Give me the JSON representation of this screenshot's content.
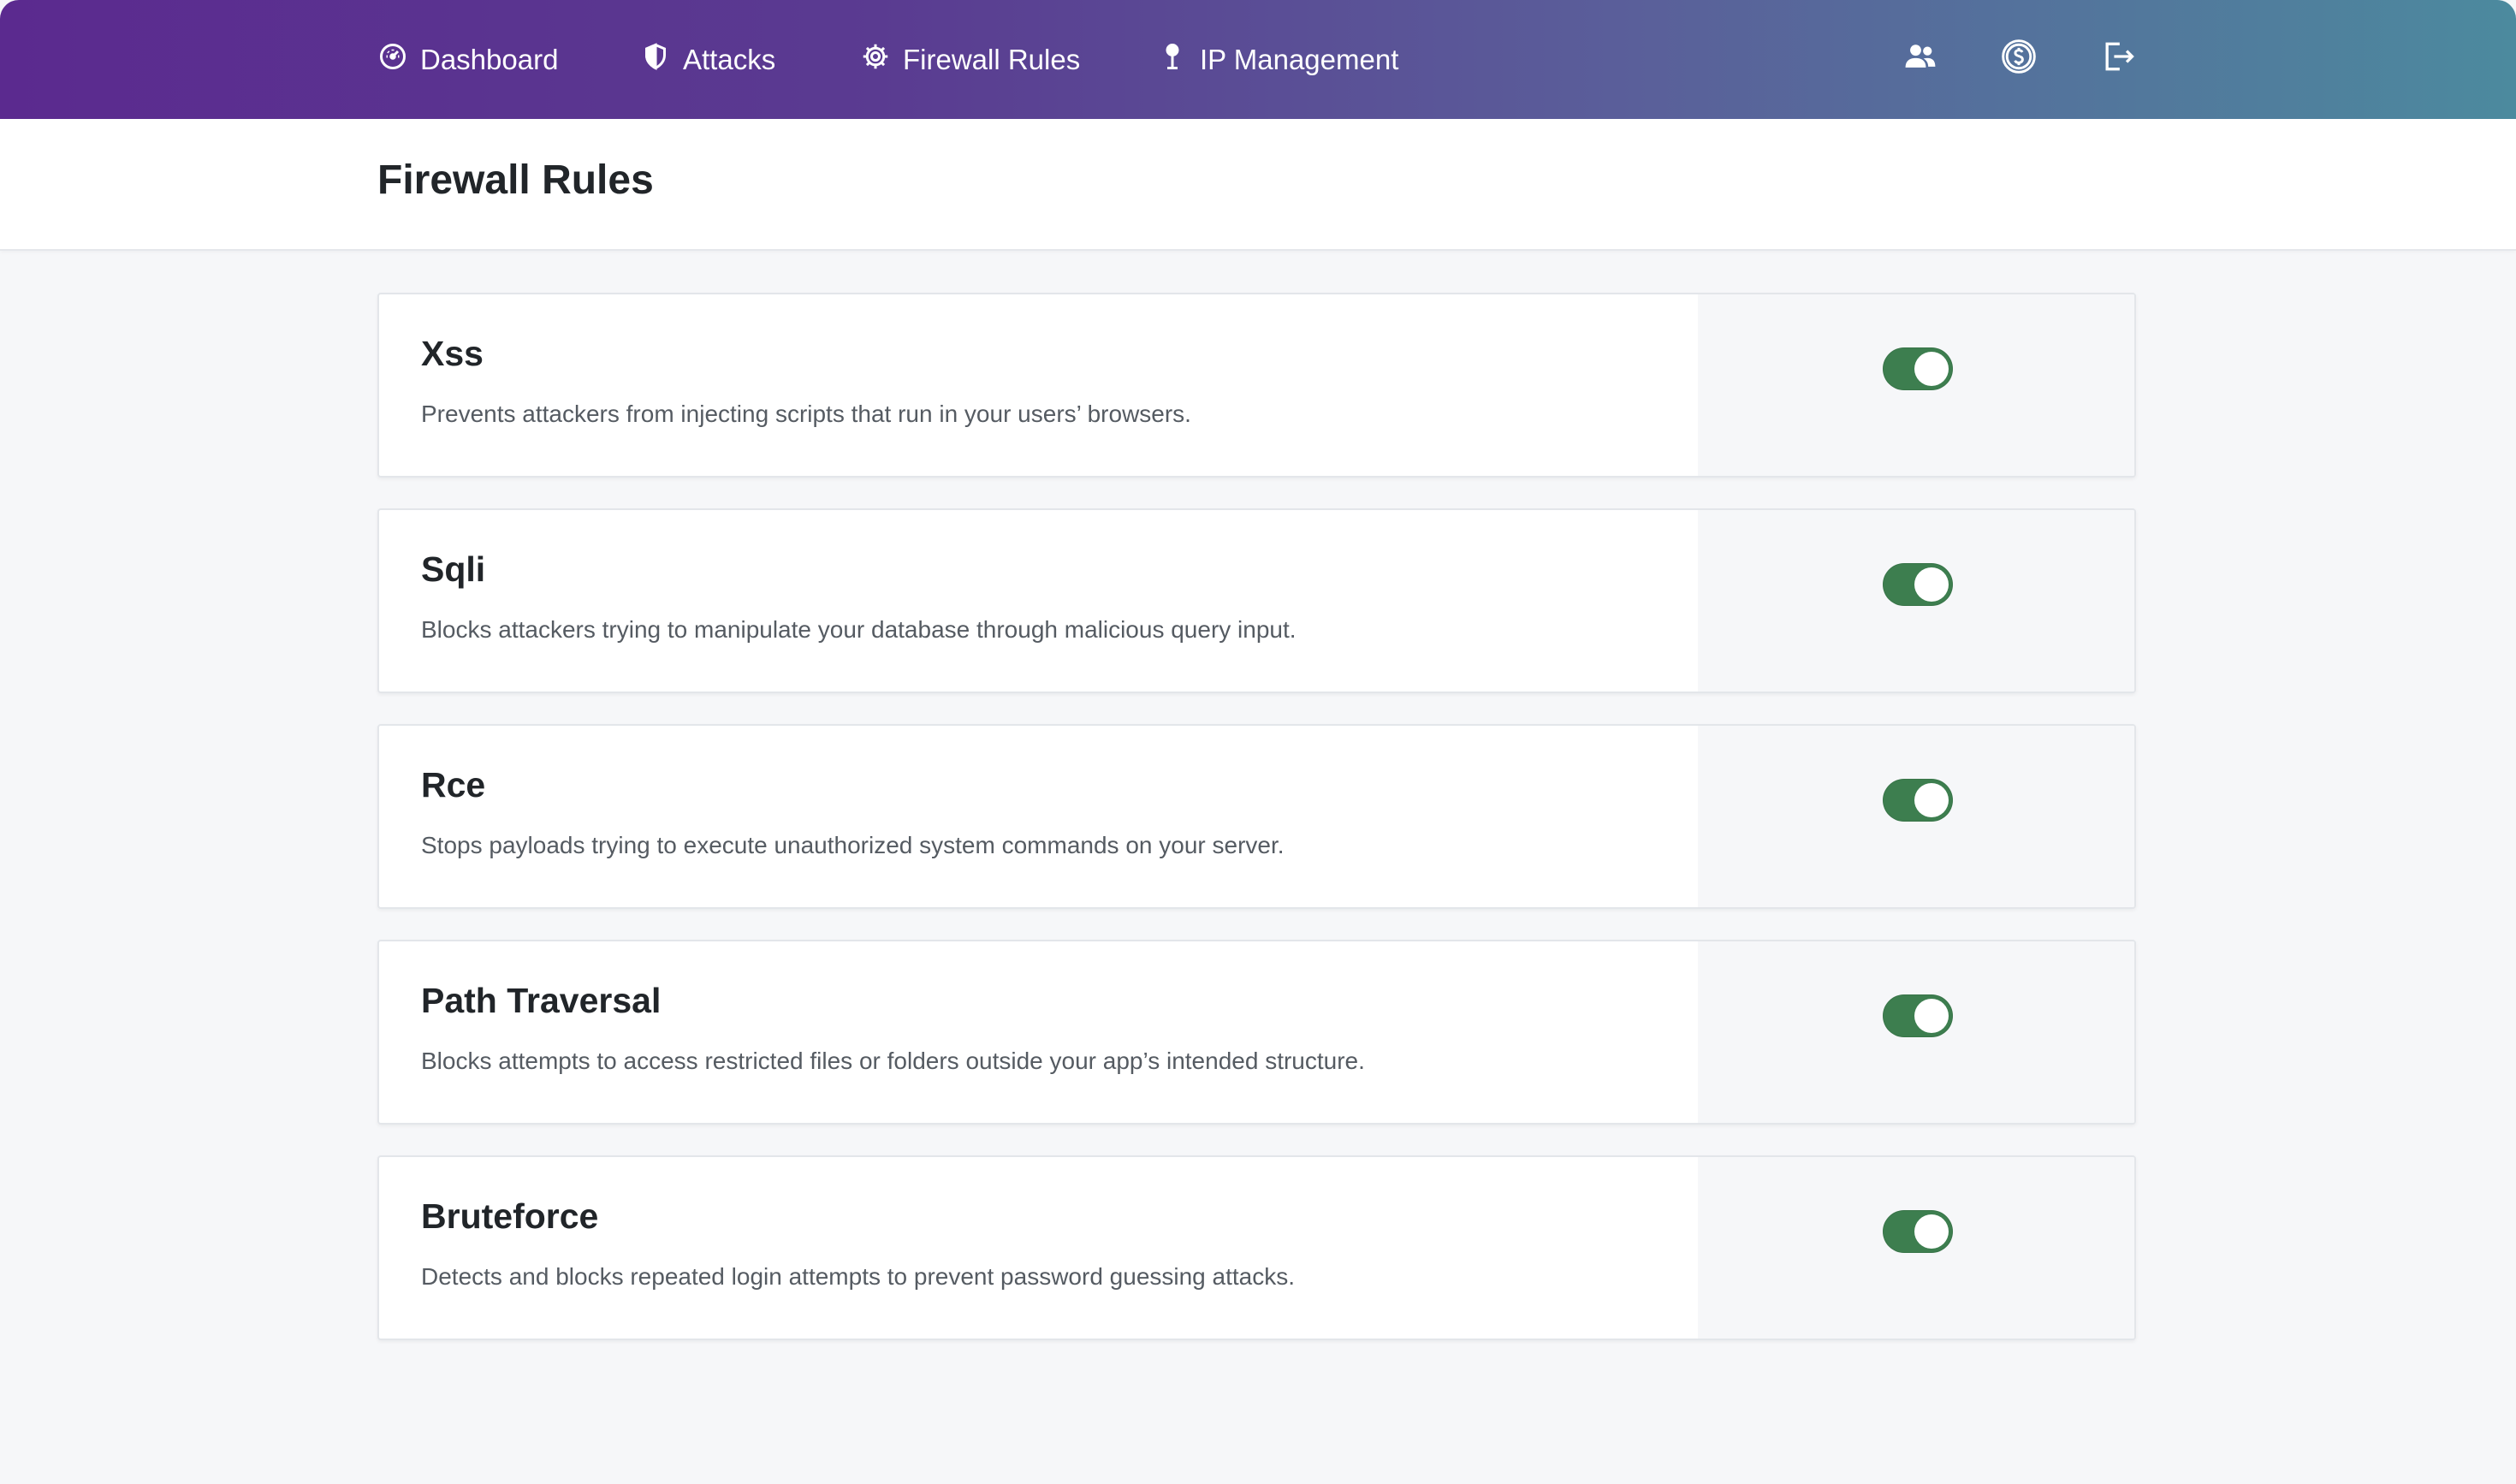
{
  "colors": {
    "nav_gradient_start": "#5b2a8f",
    "nav_gradient_end": "#4c8a9e",
    "toggle_on": "#3d7e4f",
    "page_background": "#f6f7f9"
  },
  "nav": {
    "items": [
      {
        "label": "Dashboard",
        "icon": "speedometer-icon"
      },
      {
        "label": "Attacks",
        "icon": "shield-icon"
      },
      {
        "label": "Firewall Rules",
        "icon": "gear-icon"
      },
      {
        "label": "IP Management",
        "icon": "pin-icon"
      }
    ],
    "right_icons": [
      "users-icon",
      "dollar-coin-icon",
      "logout-icon"
    ]
  },
  "page": {
    "title": "Firewall Rules"
  },
  "rules": [
    {
      "name": "Xss",
      "description": "Prevents attackers from injecting scripts that run in your users’ browsers.",
      "enabled": true
    },
    {
      "name": "Sqli",
      "description": "Blocks attackers trying to manipulate your database through malicious query input.",
      "enabled": true
    },
    {
      "name": "Rce",
      "description": "Stops payloads trying to execute unauthorized system commands on your server.",
      "enabled": true
    },
    {
      "name": "Path Traversal",
      "description": "Blocks attempts to access restricted files or folders outside your app’s intended structure.",
      "enabled": true
    },
    {
      "name": "Bruteforce",
      "description": "Detects and blocks repeated login attempts to prevent password guessing attacks.",
      "enabled": true
    }
  ]
}
